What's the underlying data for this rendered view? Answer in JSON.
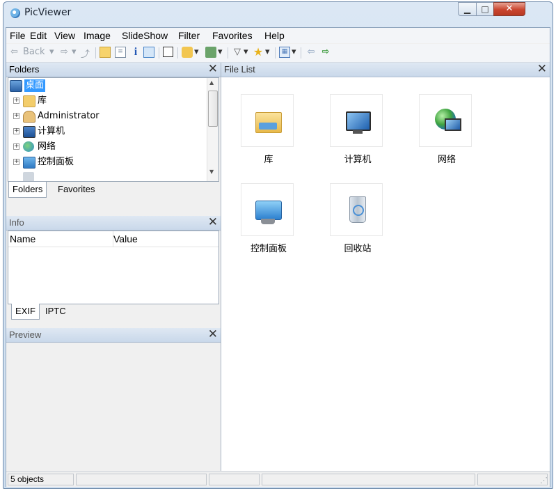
{
  "window": {
    "title": "PicViewer"
  },
  "menu": [
    "File",
    "Edit",
    "View",
    "Image",
    "SlideShow",
    "Filter",
    "Favorites",
    "Help"
  ],
  "toolbar": {
    "back_label": "Back"
  },
  "folders_panel": {
    "title": "Folders",
    "tree": [
      "桌面",
      "库",
      "Administrator",
      "计算机",
      "网络",
      "控制面板"
    ],
    "tabs": [
      "Folders",
      "Favorites"
    ]
  },
  "info_panel": {
    "title": "Info",
    "columns": [
      "Name",
      "Value"
    ],
    "tabs": [
      "EXIF",
      "IPTC"
    ]
  },
  "preview_panel": {
    "title": "Preview"
  },
  "file_list": {
    "title": "File List",
    "items": [
      {
        "label": "库",
        "icon": "library-icon"
      },
      {
        "label": "计算机",
        "icon": "computer-icon"
      },
      {
        "label": "网络",
        "icon": "network-icon"
      },
      {
        "label": "控制面板",
        "icon": "control-panel-icon"
      },
      {
        "label": "回收站",
        "icon": "recycle-bin-icon"
      }
    ]
  },
  "status": {
    "count": "5 objects"
  },
  "colors": {
    "selection": "#3399ff",
    "header": "#cfdff0"
  }
}
